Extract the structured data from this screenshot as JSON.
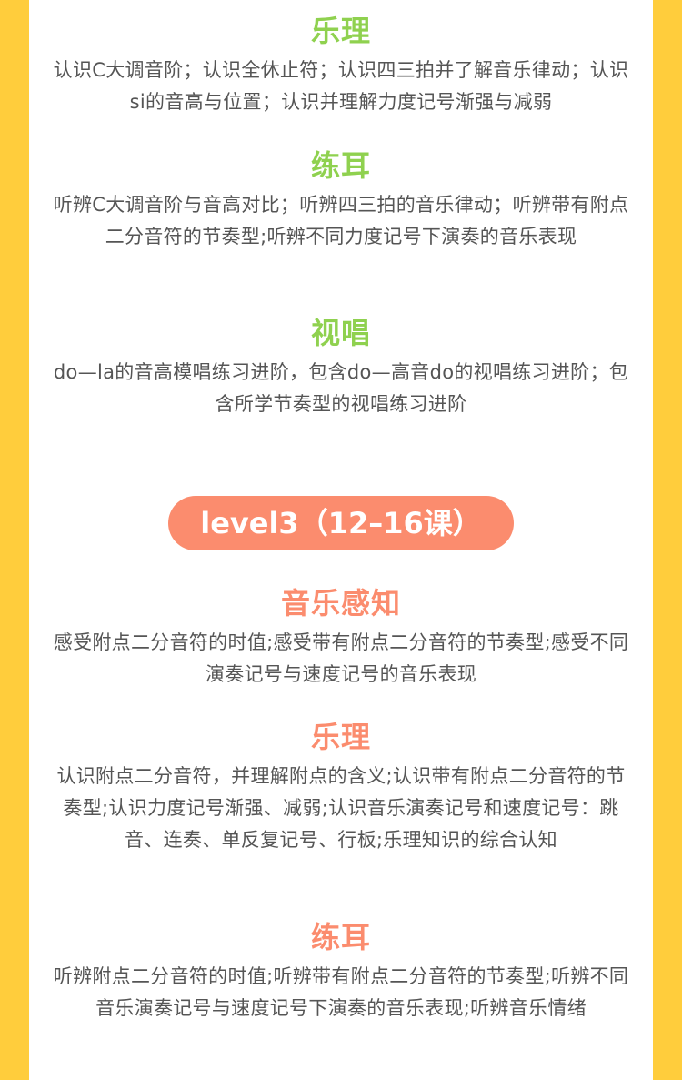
{
  "level2": {
    "theory": {
      "title": "乐理",
      "text": "认识C大调音阶；认识全休止符；认识四三拍并了解音乐律动；认识si的音高与位置；认识并理解力度记号渐强与减弱"
    },
    "ear": {
      "title": "练耳",
      "text": "听辨C大调音阶与音高对比；听辨四三拍的音乐律动；听辨带有附点二分音符的节奏型;听辨不同力度记号下演奏的音乐表现"
    },
    "sight_singing": {
      "title": "视唱",
      "text": "do—la的音高模唱练习进阶，包含do—高音do的视唱练习进阶；包含所学节奏型的视唱练习进阶"
    }
  },
  "level3": {
    "badge": "level3（12–16课）",
    "perception": {
      "title": "音乐感知",
      "text": "感受附点二分音符的时值;感受带有附点二分音符的节奏型;感受不同演奏记号与速度记号的音乐表现"
    },
    "theory": {
      "title": "乐理",
      "text": "认识附点二分音符，并理解附点的含义;认识带有附点二分音符的节奏型;认识力度记号渐强、减弱;认识音乐演奏记号和速度记号：跳音、连奏、单反复记号、行板;乐理知识的综合认知"
    },
    "ear": {
      "title": "练耳",
      "text": "听辨附点二分音符的时值;听辨带有附点二分音符的节奏型;听辨不同音乐演奏记号与速度记号下演奏的音乐表现;听辨音乐情绪"
    }
  },
  "colors": {
    "background": "#ffcd3c",
    "card": "#ffffff",
    "green_heading": "#8fd14f",
    "orange_heading": "#fb8c6e",
    "badge": "#fb8c6e",
    "body_text": "#555555"
  }
}
